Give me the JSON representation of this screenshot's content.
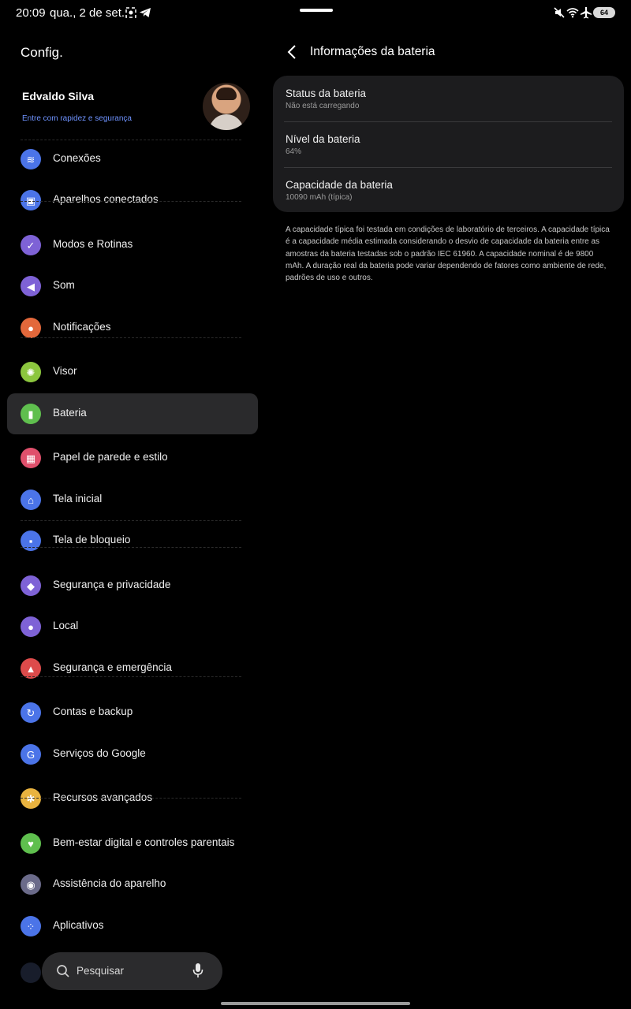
{
  "status_bar": {
    "time": "20:09",
    "date": "qua., 2 de set.",
    "battery": "64",
    "icons_left": [
      "screenshot-icon",
      "telegram-icon"
    ],
    "icons_right": [
      "mute-icon",
      "wifi-icon",
      "airplane-icon",
      "battery-icon"
    ]
  },
  "left_pane": {
    "title": "Config.",
    "profile": {
      "name": "Edvaldo Silva",
      "subtitle": "Entre com rapidez e segurança"
    },
    "menu": [
      {
        "label": "Conexões",
        "icon": "wifi-icon",
        "color": "#4b74e8",
        "glyph": "≋"
      },
      {
        "label": "Aparelhos conectados",
        "icon": "devices-icon",
        "color": "#4b74e8",
        "glyph": "▣"
      },
      {
        "label": "Modos e Rotinas",
        "icon": "modes-icon",
        "color": "#7e62d6",
        "glyph": "✓"
      },
      {
        "label": "Som",
        "icon": "sound-icon",
        "color": "#7e62d6",
        "glyph": "◀"
      },
      {
        "label": "Notificações",
        "icon": "bell-icon",
        "color": "#e3683b",
        "glyph": "●"
      },
      {
        "label": "Visor",
        "icon": "display-icon",
        "color": "#8cc63e",
        "glyph": "✺"
      },
      {
        "label": "Bateria",
        "icon": "battery-icon",
        "color": "#5fbf4e",
        "glyph": "▮"
      },
      {
        "label": "Papel de parede e estilo",
        "icon": "wallpaper-icon",
        "color": "#e0506c",
        "glyph": "▦"
      },
      {
        "label": "Tela inicial",
        "icon": "home-icon",
        "color": "#4b74e8",
        "glyph": "⌂"
      },
      {
        "label": "Tela de bloqueio",
        "icon": "lock-icon",
        "color": "#4b74e8",
        "glyph": "▪"
      },
      {
        "label": "Segurança e privacidade",
        "icon": "shield-icon",
        "color": "#7e62d6",
        "glyph": "◆"
      },
      {
        "label": "Local",
        "icon": "location-icon",
        "color": "#7e62d6",
        "glyph": "●"
      },
      {
        "label": "Segurança e emergência",
        "icon": "emergency-icon",
        "color": "#dd4b4b",
        "glyph": "▲"
      },
      {
        "label": "Contas e backup",
        "icon": "sync-icon",
        "color": "#4b74e8",
        "glyph": "↻"
      },
      {
        "label": "Serviços do Google",
        "icon": "google-icon",
        "color": "#4b74e8",
        "glyph": "G"
      },
      {
        "label": "Recursos avançados",
        "icon": "gear-icon",
        "color": "#e9b33f",
        "glyph": "✱"
      },
      {
        "label": "Bem-estar digital e controles parentais",
        "icon": "wellbeing-icon",
        "color": "#5fbf4e",
        "glyph": "♥"
      },
      {
        "label": "Assistência do aparelho",
        "icon": "device-care-icon",
        "color": "#6b6b8a",
        "glyph": "◉"
      },
      {
        "label": "Aplicativos",
        "icon": "apps-icon",
        "color": "#4b74e8",
        "glyph": "⁘"
      }
    ],
    "search": {
      "placeholder": "Pesquisar"
    }
  },
  "right_pane": {
    "title": "Informações da bateria",
    "rows": [
      {
        "title": "Status da bateria",
        "value": "Não está carregando"
      },
      {
        "title": "Nível da bateria",
        "value": "64%"
      },
      {
        "title": "Capacidade da bateria",
        "value": "10090 mAh (típica)"
      }
    ],
    "note": "A capacidade típica foi testada em condições de laboratório de terceiros. A capacidade típica é a capacidade média estimada considerando o desvio de capacidade da bateria entre as amostras da bateria testadas sob o padrão IEC 61960. A capacidade nominal é de 9800 mAh. A duração real da bateria pode variar dependendo de fatores como ambiente de rede, padrões de uso e outros."
  },
  "colors": {
    "accent": "#6f93ff",
    "background": "#000000",
    "card": "#1c1c1e",
    "active_item": "#2a2a2c"
  }
}
